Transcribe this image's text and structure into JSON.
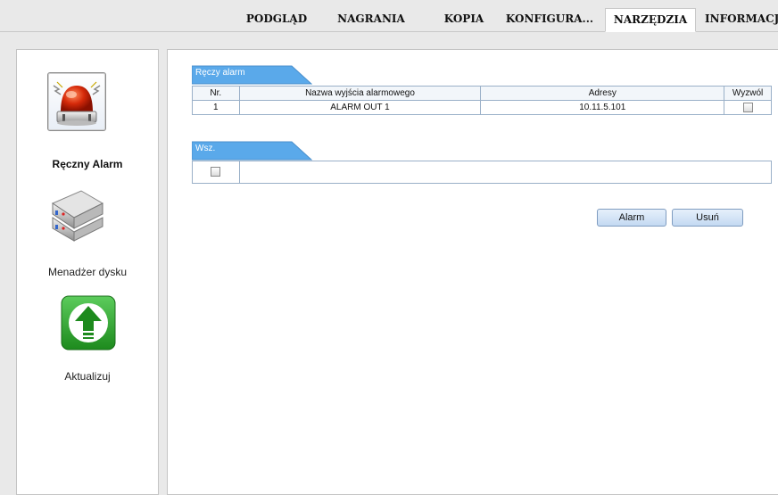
{
  "nav": {
    "tabs": [
      {
        "label": "PODGLĄD"
      },
      {
        "label": "NAGRANIA"
      },
      {
        "label": "KOPIA"
      },
      {
        "label": "KONFIGURA..."
      },
      {
        "label": "NARZĘDZIA"
      },
      {
        "label": "INFORMACJ"
      }
    ],
    "active_tab": "NARZĘDZIA"
  },
  "sidebar": {
    "items": [
      {
        "label": "Ręczny Alarm",
        "icon": "alarm-siren-icon",
        "active": true
      },
      {
        "label": "Menadżer dysku",
        "icon": "hard-disk-icon",
        "active": false
      },
      {
        "label": "Aktualizuj",
        "icon": "upload-arrow-icon",
        "active": false
      }
    ]
  },
  "manual_alarm": {
    "section_title": "Ręczy alarm",
    "columns": [
      "Nr.",
      "Nazwa wyjścia alarmowego",
      "Adresy",
      "Wyzwól"
    ],
    "rows": [
      {
        "nr": "1",
        "name": "ALARM OUT 1",
        "address": "10.11.5.101",
        "trigger": false
      }
    ]
  },
  "all_section": {
    "title": "Wsz.",
    "checked": false
  },
  "buttons": {
    "alarm": "Alarm",
    "clear": "Usuń"
  },
  "colors": {
    "section_tab": "#5aa9ea",
    "button_border": "#7f9cc0",
    "grid_border": "#9ab0c8"
  }
}
